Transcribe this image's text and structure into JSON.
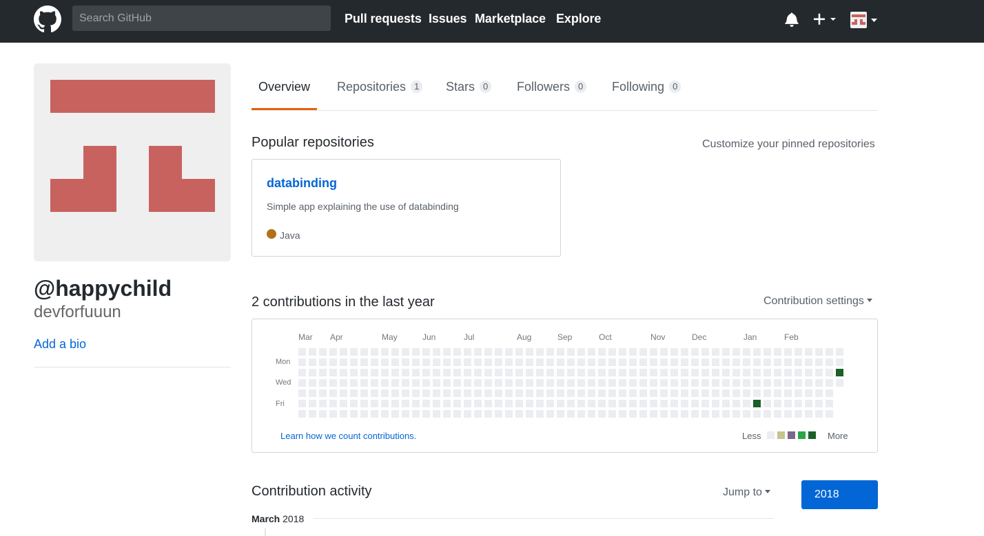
{
  "header": {
    "search_placeholder": "Search GitHub",
    "nav": [
      "Pull requests",
      "Issues",
      "Marketplace",
      "Explore"
    ],
    "icons": [
      "github-logo-icon",
      "bell-icon",
      "plus-icon",
      "avatar-icon",
      "chevron-down-icon"
    ]
  },
  "profile": {
    "username": "@happychild",
    "fullname": "devforfuuun",
    "add_bio": "Add a bio",
    "avatar_color": "#c8625f"
  },
  "tabs": [
    {
      "label": "Overview",
      "count": null,
      "selected": true
    },
    {
      "label": "Repositories",
      "count": "1"
    },
    {
      "label": "Stars",
      "count": "0"
    },
    {
      "label": "Followers",
      "count": "0"
    },
    {
      "label": "Following",
      "count": "0"
    }
  ],
  "popular": {
    "title": "Popular repositories",
    "customize": "Customize your pinned repositories",
    "repo": {
      "name": "databinding",
      "description": "Simple app explaining the use of databinding",
      "language": "Java",
      "language_color": "#b07219"
    }
  },
  "contributions": {
    "title": "2 contributions in the last year",
    "settings": "Contribution settings",
    "months": [
      "Mar",
      "Apr",
      "May",
      "Jun",
      "Jul",
      "Aug",
      "Sep",
      "Oct",
      "Nov",
      "Dec",
      "Jan",
      "Feb"
    ],
    "weekdays": [
      "Mon",
      "Wed",
      "Fri"
    ],
    "learn_link": "Learn how we count contributions.",
    "legend_less": "Less",
    "legend_more": "More",
    "legend_colors": [
      "#ebedf0",
      "#c6c48f",
      "#7a6a8a",
      "#28a745",
      "#196127"
    ],
    "empty_color": "#ebedf0",
    "active_color": "#196127",
    "active_days": [
      {
        "week": 44,
        "weekday": 5
      },
      {
        "week": 52,
        "weekday": 2
      }
    ],
    "total_weeks": 53,
    "last_week_days": 4
  },
  "activity": {
    "title": "Contribution activity",
    "jump_to": "Jump to",
    "year": "2018",
    "month_bold": "March",
    "month_year": "2018"
  }
}
